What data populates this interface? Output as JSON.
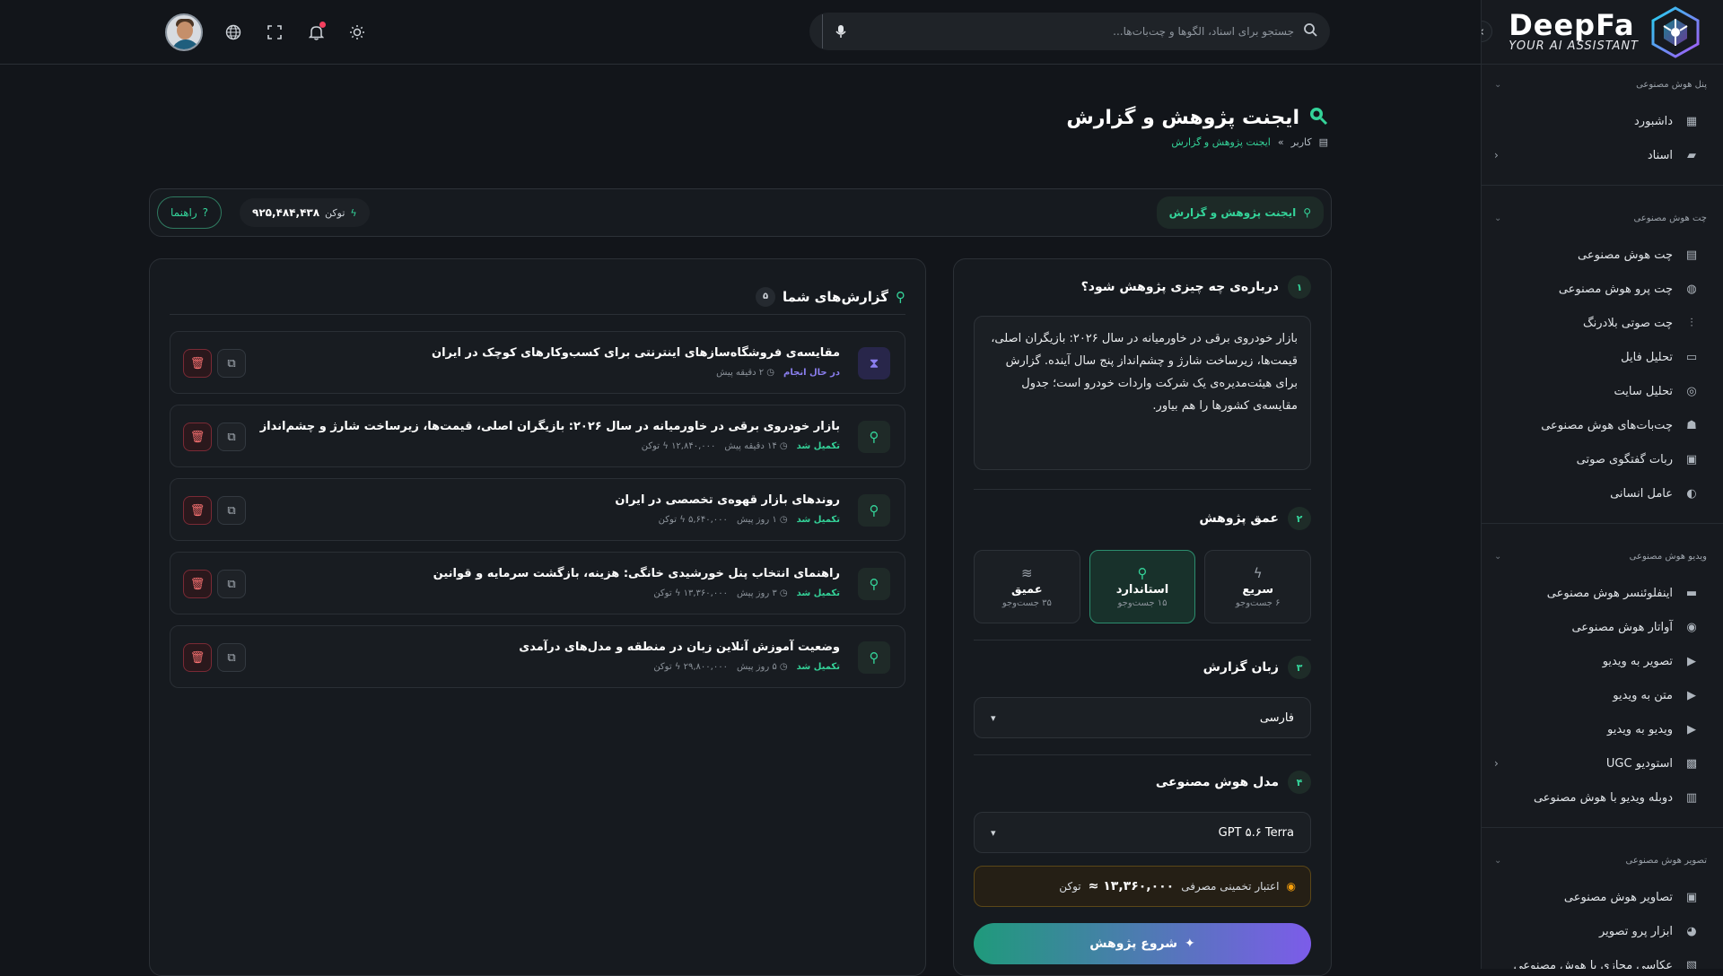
{
  "brand": {
    "name": "DeepFa",
    "tagline": "YOUR AI ASSISTANT"
  },
  "sidebar": {
    "sections": [
      {
        "title": "پنل هوش مصنوعی",
        "items": [
          {
            "label": "داشبورد",
            "icon": "dashboard-icon",
            "arrow": false
          },
          {
            "label": "اسناد",
            "icon": "folder-icon",
            "arrow": true
          }
        ]
      },
      {
        "title": "چت هوش مصنوعی",
        "items": [
          {
            "label": "چت هوش مصنوعی",
            "icon": "chat-icon",
            "arrow": false
          },
          {
            "label": "چت پرو هوش مصنوعی",
            "icon": "chats-icon",
            "arrow": false
          },
          {
            "label": "چت صوتی بلادرنگ",
            "icon": "waveform-icon",
            "arrow": false
          },
          {
            "label": "تحلیل فایل",
            "icon": "file-icon",
            "arrow": false
          },
          {
            "label": "تحلیل سایت",
            "icon": "globe-icon",
            "arrow": false
          },
          {
            "label": "چت‌بات‌های هوش مصنوعی",
            "icon": "robot-icon",
            "arrow": false
          },
          {
            "label": "ربات گفتگوی صوتی",
            "icon": "voice-bot-icon",
            "arrow": false
          },
          {
            "label": "عامل انسانی",
            "icon": "headset-icon",
            "arrow": false
          }
        ]
      },
      {
        "title": "ویدیو هوش مصنوعی",
        "items": [
          {
            "label": "اینفلوئنسر هوش مصنوعی",
            "icon": "camera-icon",
            "arrow": false
          },
          {
            "label": "آواتار هوش مصنوعی",
            "icon": "avatar-icon",
            "arrow": false
          },
          {
            "label": "تصویر به ویدیو",
            "icon": "video-icon",
            "arrow": false
          },
          {
            "label": "متن به ویدیو",
            "icon": "video-text-icon",
            "arrow": false
          },
          {
            "label": "ویدیو به ویدیو",
            "icon": "video-video-icon",
            "arrow": false
          },
          {
            "label": "استودیو UGC",
            "icon": "studio-icon",
            "arrow": true
          },
          {
            "label": "دوبله ویدیو با هوش مصنوعی",
            "icon": "dub-icon",
            "arrow": false
          }
        ]
      },
      {
        "title": "تصویر هوش مصنوعی",
        "items": [
          {
            "label": "تصاویر هوش مصنوعی",
            "icon": "image-icon",
            "arrow": false
          },
          {
            "label": "ابزار پرو تصویر",
            "icon": "palette-icon",
            "arrow": false
          },
          {
            "label": "عکاسی مجازی با هوش مصنوعی",
            "icon": "photo-icon",
            "arrow": false
          }
        ]
      }
    ]
  },
  "topbar": {
    "search_placeholder": "جستجو برای اسناد، الگوها و چت‌بات‌ها..."
  },
  "page": {
    "title": "ایجنت پژوهش و گزارش",
    "breadcrumb": [
      "کاربر",
      "»",
      "ایجنت پژوهش و گزارش"
    ]
  },
  "toolbar": {
    "tab_label": "ایجنت پژوهش و گزارش",
    "token_label": "توکن",
    "token_value": "۹۲۵,۴۸۴,۴۳۸",
    "guide_label": "راهنما"
  },
  "form": {
    "step1": {
      "num": "۱",
      "title": "درباره‌ی چه چیزی پژوهش شود؟",
      "text": "بازار خودروی برقی در خاورمیانه در سال ۲۰۲۶: بازیگران اصلی، قیمت‌ها، زیرساخت شارژ و چشم‌انداز پنج سال آینده. گزارش برای هیئت‌مدیره‌ی یک شرکت واردات خودرو است؛ جدول مقایسه‌ی کشورها را هم بیاور."
    },
    "step2": {
      "num": "۲",
      "title": "عمق پژوهش",
      "options": [
        {
          "name": "سریع",
          "sub": "۶ جست‌وجو",
          "icon": "bolt-icon"
        },
        {
          "name": "استاندارد",
          "sub": "۱۵ جست‌وجو",
          "icon": "search-icon"
        },
        {
          "name": "عمیق",
          "sub": "۳۵ جست‌وجو",
          "icon": "layers-icon"
        }
      ]
    },
    "step3": {
      "num": "۳",
      "title": "زبان گزارش",
      "value": "فارسی"
    },
    "step4": {
      "num": "۴",
      "title": "مدل هوش مصنوعی",
      "value": "GPT ۵.۶ Terra"
    },
    "cost": {
      "label": "اعتبار تخمینی مصرفی",
      "value": "۱۳,۳۶۰,۰۰۰ ≈",
      "unit": "توکن"
    },
    "start_label": "شروع پژوهش"
  },
  "reports": {
    "title": "گزارش‌های شما",
    "count": "۵",
    "items": [
      {
        "title": "مقایسه‌ی فروشگاه‌سازهای اینترنتی برای کسب‌وکارهای کوچک در ایران",
        "status": "در حال انجام",
        "time": "۲ دقیقه پیش",
        "tokens": ""
      },
      {
        "title": "بازار خودروی برقی در خاورمیانه در سال ۲۰۲۶: بازیگران اصلی، قیمت‌ها، زیرساخت شارژ و چشم‌انداز",
        "status": "تکمیل شد",
        "time": "۱۴ دقیقه پیش",
        "tokens": "۱۲,۸۴۰,۰۰۰ توکن"
      },
      {
        "title": "روندهای بازار قهوه‌ی تخصصی در ایران",
        "status": "تکمیل شد",
        "time": "۱ روز پیش",
        "tokens": "۵,۶۴۰,۰۰۰ توکن"
      },
      {
        "title": "راهنمای انتخاب پنل خورشیدی خانگی: هزینه، بازگشت سرمایه و قوانین",
        "status": "تکمیل شد",
        "time": "۳ روز پیش",
        "tokens": "۱۳,۳۶۰,۰۰۰ توکن"
      },
      {
        "title": "وضعیت آموزش آنلاین زبان در منطقه و مدل‌های درآمدی",
        "status": "تکمیل شد",
        "time": "۵ روز پیش",
        "tokens": "۲۹,۸۰۰,۰۰۰ توکن"
      }
    ]
  },
  "colors": {
    "accent": "#34d399",
    "danger": "#f87171",
    "running": "#8b7ff0",
    "bg": "#12151a"
  }
}
